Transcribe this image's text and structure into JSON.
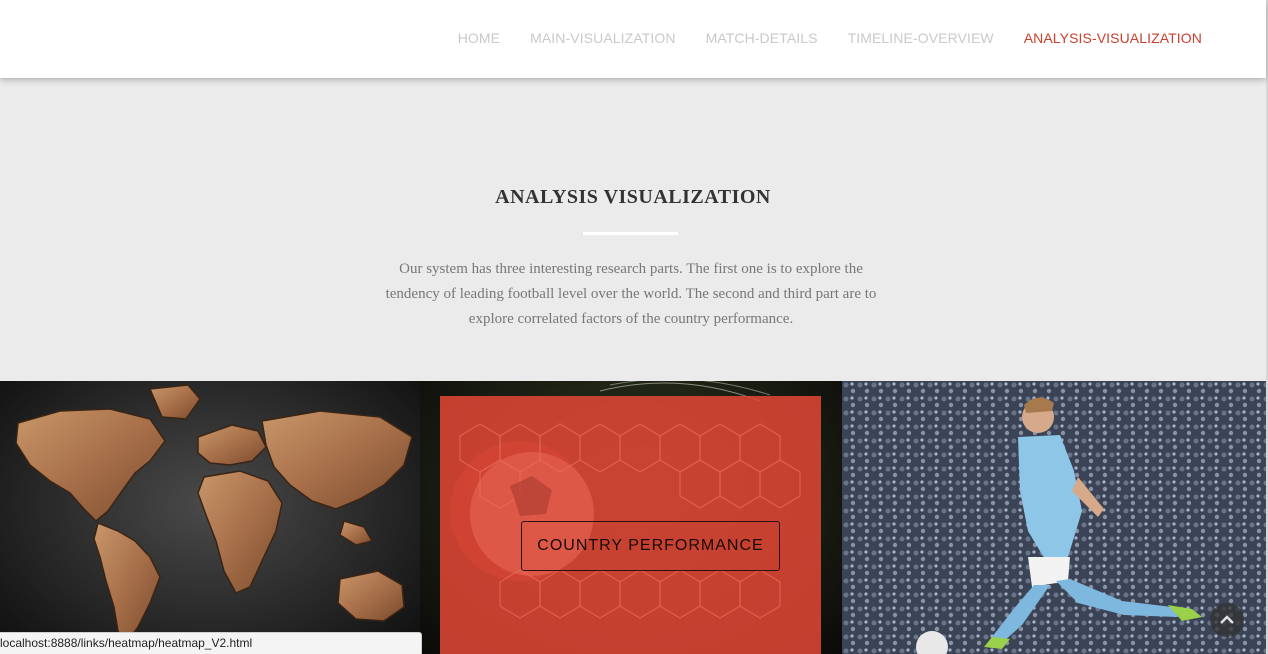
{
  "nav": {
    "items": [
      {
        "label": "HOME",
        "active": false
      },
      {
        "label": "MAIN-VISUALIZATION",
        "active": false
      },
      {
        "label": "MATCH-DETAILS",
        "active": false
      },
      {
        "label": "TIMELINE-OVERVIEW",
        "active": false
      },
      {
        "label": "ANALYSIS-VISUALIZATION",
        "active": true
      }
    ]
  },
  "section": {
    "title": "ANALYSIS VISUALIZATION",
    "description": "Our system has three interesting research parts. The first one is to explore the tendency of leading football level over the world. The second and third part are to explore correlated factors of the country performance."
  },
  "gallery": {
    "tiles": [
      {
        "image": "world-map-image"
      },
      {
        "image": "football-net-image",
        "button_label": "COUNTRY PERFORMANCE"
      },
      {
        "image": "football-player-image"
      }
    ]
  },
  "status_bar": {
    "url": "localhost:8888/links/heatmap/heatmap_V2.html"
  },
  "colors": {
    "accent": "#c8402e",
    "nav_inactive": "#c9c9c9",
    "overlay": "#de4634",
    "page_bg": "#ebebeb"
  }
}
